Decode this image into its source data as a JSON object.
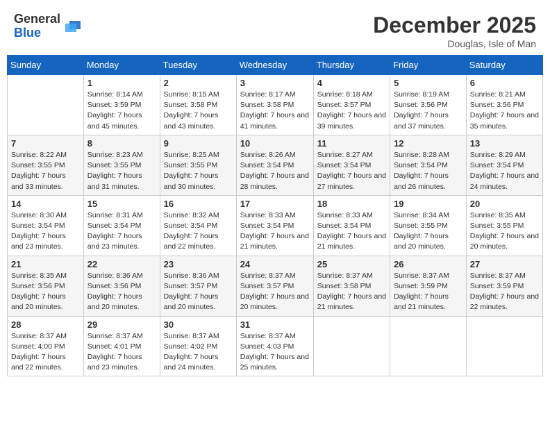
{
  "header": {
    "logo_line1": "General",
    "logo_line2": "Blue",
    "month": "December 2025",
    "location": "Douglas, Isle of Man"
  },
  "weekdays": [
    "Sunday",
    "Monday",
    "Tuesday",
    "Wednesday",
    "Thursday",
    "Friday",
    "Saturday"
  ],
  "weeks": [
    [
      {
        "day": "",
        "sunrise": "",
        "sunset": "",
        "daylight": ""
      },
      {
        "day": "1",
        "sunrise": "Sunrise: 8:14 AM",
        "sunset": "Sunset: 3:59 PM",
        "daylight": "Daylight: 7 hours and 45 minutes."
      },
      {
        "day": "2",
        "sunrise": "Sunrise: 8:15 AM",
        "sunset": "Sunset: 3:58 PM",
        "daylight": "Daylight: 7 hours and 43 minutes."
      },
      {
        "day": "3",
        "sunrise": "Sunrise: 8:17 AM",
        "sunset": "Sunset: 3:58 PM",
        "daylight": "Daylight: 7 hours and 41 minutes."
      },
      {
        "day": "4",
        "sunrise": "Sunrise: 8:18 AM",
        "sunset": "Sunset: 3:57 PM",
        "daylight": "Daylight: 7 hours and 39 minutes."
      },
      {
        "day": "5",
        "sunrise": "Sunrise: 8:19 AM",
        "sunset": "Sunset: 3:56 PM",
        "daylight": "Daylight: 7 hours and 37 minutes."
      },
      {
        "day": "6",
        "sunrise": "Sunrise: 8:21 AM",
        "sunset": "Sunset: 3:56 PM",
        "daylight": "Daylight: 7 hours and 35 minutes."
      }
    ],
    [
      {
        "day": "7",
        "sunrise": "Sunrise: 8:22 AM",
        "sunset": "Sunset: 3:55 PM",
        "daylight": "Daylight: 7 hours and 33 minutes."
      },
      {
        "day": "8",
        "sunrise": "Sunrise: 8:23 AM",
        "sunset": "Sunset: 3:55 PM",
        "daylight": "Daylight: 7 hours and 31 minutes."
      },
      {
        "day": "9",
        "sunrise": "Sunrise: 8:25 AM",
        "sunset": "Sunset: 3:55 PM",
        "daylight": "Daylight: 7 hours and 30 minutes."
      },
      {
        "day": "10",
        "sunrise": "Sunrise: 8:26 AM",
        "sunset": "Sunset: 3:54 PM",
        "daylight": "Daylight: 7 hours and 28 minutes."
      },
      {
        "day": "11",
        "sunrise": "Sunrise: 8:27 AM",
        "sunset": "Sunset: 3:54 PM",
        "daylight": "Daylight: 7 hours and 27 minutes."
      },
      {
        "day": "12",
        "sunrise": "Sunrise: 8:28 AM",
        "sunset": "Sunset: 3:54 PM",
        "daylight": "Daylight: 7 hours and 26 minutes."
      },
      {
        "day": "13",
        "sunrise": "Sunrise: 8:29 AM",
        "sunset": "Sunset: 3:54 PM",
        "daylight": "Daylight: 7 hours and 24 minutes."
      }
    ],
    [
      {
        "day": "14",
        "sunrise": "Sunrise: 8:30 AM",
        "sunset": "Sunset: 3:54 PM",
        "daylight": "Daylight: 7 hours and 23 minutes."
      },
      {
        "day": "15",
        "sunrise": "Sunrise: 8:31 AM",
        "sunset": "Sunset: 3:54 PM",
        "daylight": "Daylight: 7 hours and 23 minutes."
      },
      {
        "day": "16",
        "sunrise": "Sunrise: 8:32 AM",
        "sunset": "Sunset: 3:54 PM",
        "daylight": "Daylight: 7 hours and 22 minutes."
      },
      {
        "day": "17",
        "sunrise": "Sunrise: 8:33 AM",
        "sunset": "Sunset: 3:54 PM",
        "daylight": "Daylight: 7 hours and 21 minutes."
      },
      {
        "day": "18",
        "sunrise": "Sunrise: 8:33 AM",
        "sunset": "Sunset: 3:54 PM",
        "daylight": "Daylight: 7 hours and 21 minutes."
      },
      {
        "day": "19",
        "sunrise": "Sunrise: 8:34 AM",
        "sunset": "Sunset: 3:55 PM",
        "daylight": "Daylight: 7 hours and 20 minutes."
      },
      {
        "day": "20",
        "sunrise": "Sunrise: 8:35 AM",
        "sunset": "Sunset: 3:55 PM",
        "daylight": "Daylight: 7 hours and 20 minutes."
      }
    ],
    [
      {
        "day": "21",
        "sunrise": "Sunrise: 8:35 AM",
        "sunset": "Sunset: 3:56 PM",
        "daylight": "Daylight: 7 hours and 20 minutes."
      },
      {
        "day": "22",
        "sunrise": "Sunrise: 8:36 AM",
        "sunset": "Sunset: 3:56 PM",
        "daylight": "Daylight: 7 hours and 20 minutes."
      },
      {
        "day": "23",
        "sunrise": "Sunrise: 8:36 AM",
        "sunset": "Sunset: 3:57 PM",
        "daylight": "Daylight: 7 hours and 20 minutes."
      },
      {
        "day": "24",
        "sunrise": "Sunrise: 8:37 AM",
        "sunset": "Sunset: 3:57 PM",
        "daylight": "Daylight: 7 hours and 20 minutes."
      },
      {
        "day": "25",
        "sunrise": "Sunrise: 8:37 AM",
        "sunset": "Sunset: 3:58 PM",
        "daylight": "Daylight: 7 hours and 21 minutes."
      },
      {
        "day": "26",
        "sunrise": "Sunrise: 8:37 AM",
        "sunset": "Sunset: 3:59 PM",
        "daylight": "Daylight: 7 hours and 21 minutes."
      },
      {
        "day": "27",
        "sunrise": "Sunrise: 8:37 AM",
        "sunset": "Sunset: 3:59 PM",
        "daylight": "Daylight: 7 hours and 22 minutes."
      }
    ],
    [
      {
        "day": "28",
        "sunrise": "Sunrise: 8:37 AM",
        "sunset": "Sunset: 4:00 PM",
        "daylight": "Daylight: 7 hours and 22 minutes."
      },
      {
        "day": "29",
        "sunrise": "Sunrise: 8:37 AM",
        "sunset": "Sunset: 4:01 PM",
        "daylight": "Daylight: 7 hours and 23 minutes."
      },
      {
        "day": "30",
        "sunrise": "Sunrise: 8:37 AM",
        "sunset": "Sunset: 4:02 PM",
        "daylight": "Daylight: 7 hours and 24 minutes."
      },
      {
        "day": "31",
        "sunrise": "Sunrise: 8:37 AM",
        "sunset": "Sunset: 4:03 PM",
        "daylight": "Daylight: 7 hours and 25 minutes."
      },
      {
        "day": "",
        "sunrise": "",
        "sunset": "",
        "daylight": ""
      },
      {
        "day": "",
        "sunrise": "",
        "sunset": "",
        "daylight": ""
      },
      {
        "day": "",
        "sunrise": "",
        "sunset": "",
        "daylight": ""
      }
    ]
  ]
}
